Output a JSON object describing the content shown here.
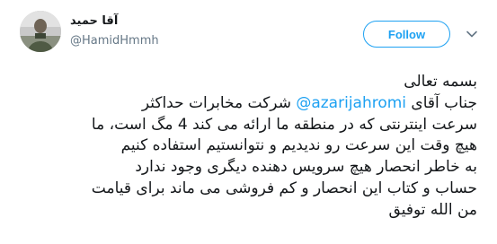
{
  "author": {
    "display_name": "آقا حمید",
    "handle": "@HamidHmmh"
  },
  "actions": {
    "follow_label": "Follow"
  },
  "icons": {
    "avatar": "avatar-photo",
    "menu": "chevron-down-icon"
  },
  "colors": {
    "accent": "#1da1f2",
    "text": "#14171a",
    "muted": "#657786"
  },
  "tweet": {
    "line1": "بسمه تعالی",
    "line2_before": "جناب آقای ",
    "mention": "@azarijahromi",
    "line2_after": " شرکت مخابرات حداکثر",
    "line3": "سرعت اینترنتی که در منطقه ما ارائه می کند 4 مگ است، ما",
    "line4": "هیچ وقت این سرعت رو ندیدیم و نتوانستیم استفاده کنیم",
    "line5": "به خاطر انحصار هیچ سرویس دهنده دیگری  وجود ندارد",
    "line6": "حساب و کتاب این انحصار و کم فروشی می ماند برای قیامت",
    "line7": "من الله توفیق"
  }
}
